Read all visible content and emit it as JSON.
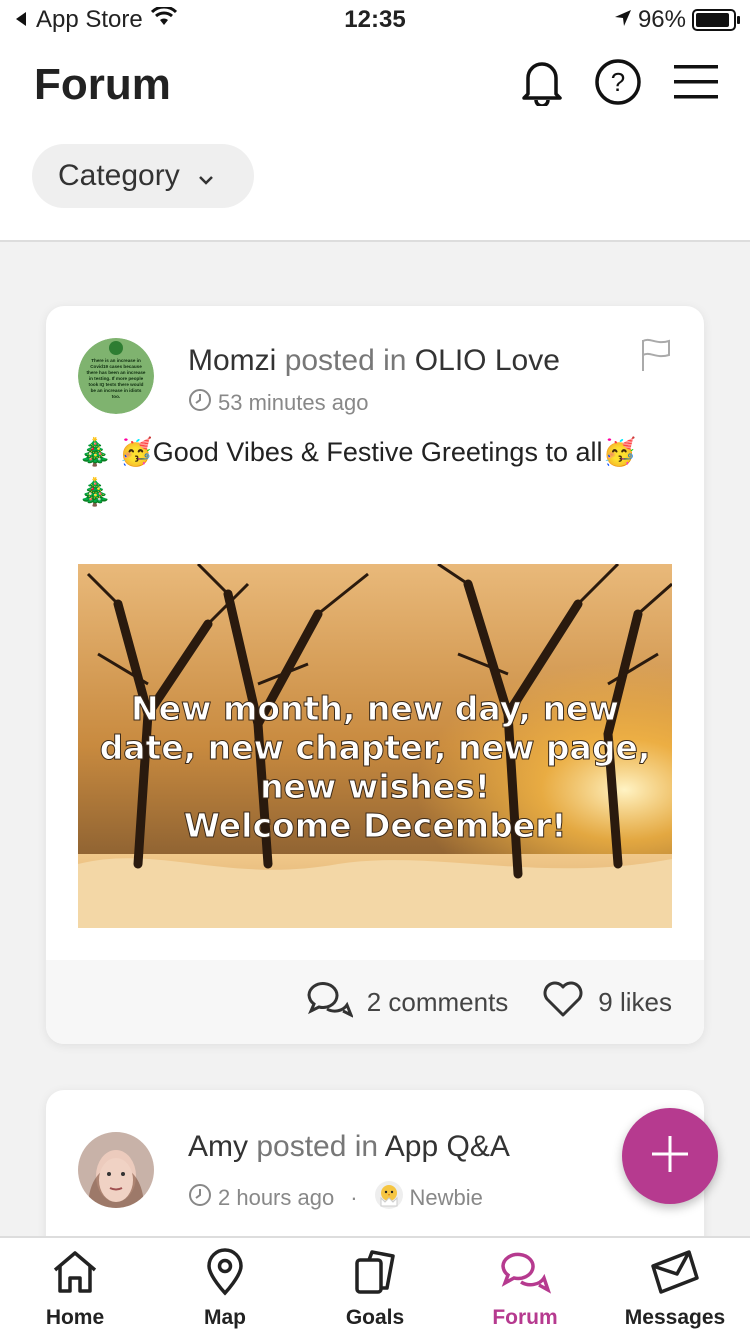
{
  "status": {
    "carrier": "App Store",
    "time": "12:35",
    "battery": "96%"
  },
  "header": {
    "title": "Forum",
    "category_label": "Category"
  },
  "posts": [
    {
      "author": "Momzi",
      "posted_in": "posted in",
      "group": "OLIO Love",
      "time": "53 minutes ago",
      "text_prefix": "🎄 🥳",
      "text": "Good Vibes & Festive Greetings to all",
      "text_suffix": "🥳",
      "text_line2": "🎄",
      "avatar_text": "There is an increase in Covid19 cases because there has been an increase in testing. If more people took IQ tests there would be an increase in idiots too.",
      "image_text": [
        "New month, new day, new",
        "date, new chapter, new page,",
        "new wishes!",
        "Welcome December!"
      ],
      "comments": "2 comments",
      "likes": "9 likes"
    },
    {
      "author": "Amy",
      "posted_in": "posted in",
      "group": "App Q&A",
      "time": "2 hours ago",
      "badge": "Newbie"
    }
  ],
  "nav": [
    {
      "label": "Home",
      "icon": "home-icon"
    },
    {
      "label": "Map",
      "icon": "map-pin-icon"
    },
    {
      "label": "Goals",
      "icon": "goals-icon"
    },
    {
      "label": "Forum",
      "icon": "forum-icon",
      "active": true
    },
    {
      "label": "Messages",
      "icon": "envelope-icon"
    }
  ],
  "colors": {
    "accent": "#b63a8f",
    "text": "#222222",
    "muted": "#777777"
  }
}
